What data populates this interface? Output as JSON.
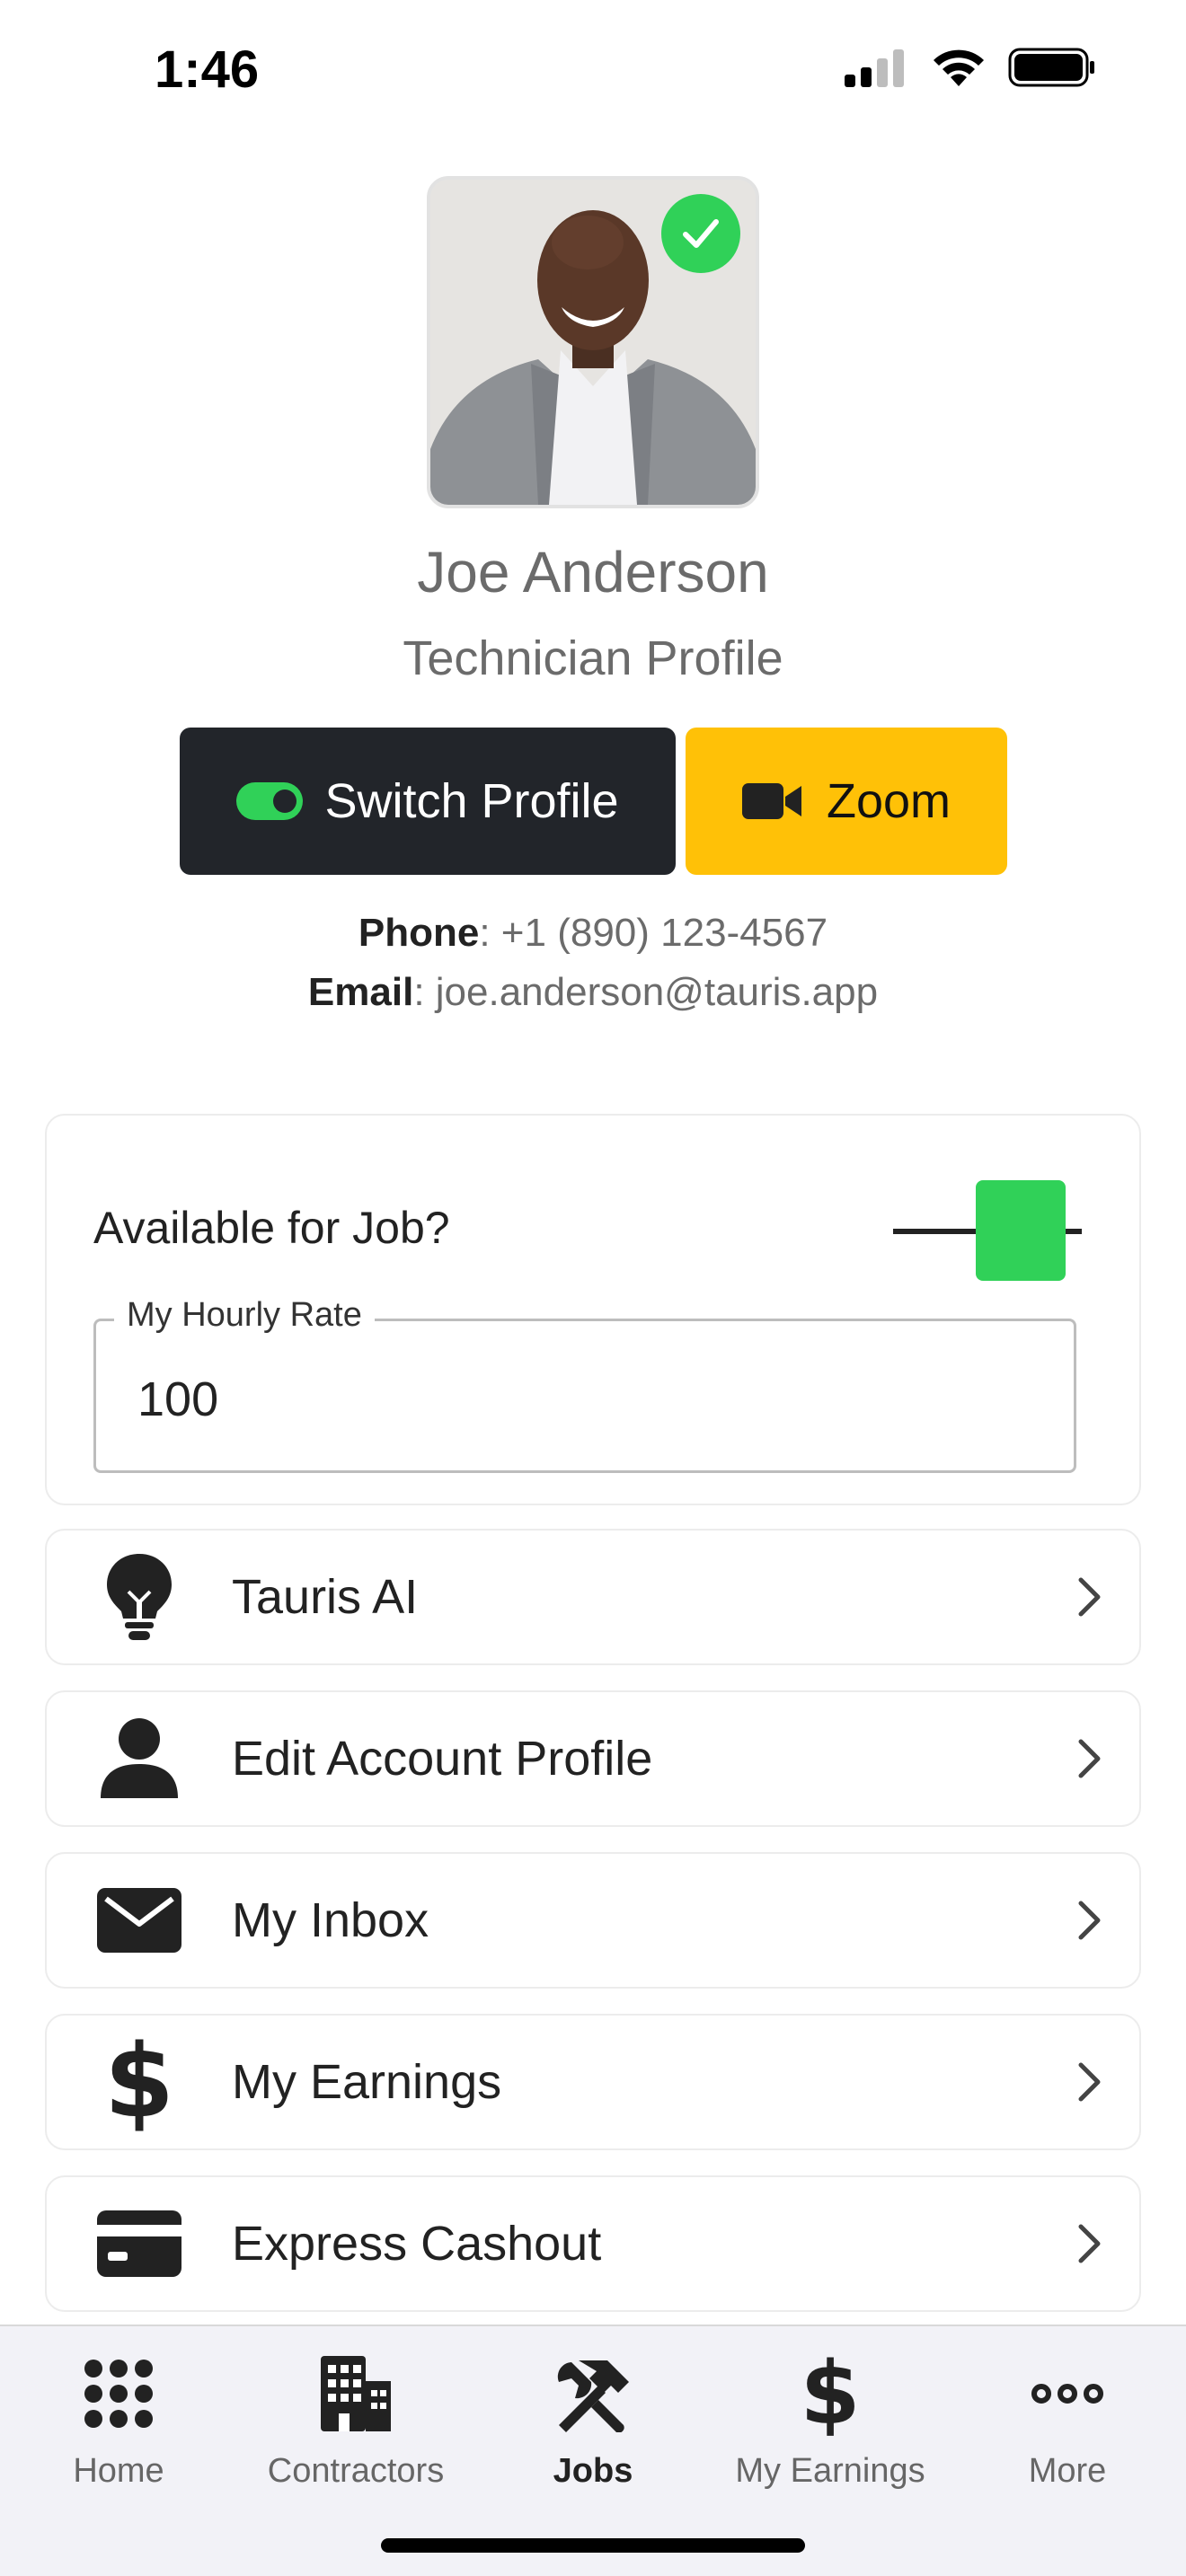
{
  "status_bar": {
    "time": "1:46"
  },
  "profile": {
    "name": "Joe Anderson",
    "role": "Technician Profile",
    "phone_label": "Phone",
    "phone_value": ": +1 (890) 123-4567",
    "email_label": "Email",
    "email_value": ": joe.anderson@tauris.app"
  },
  "actions": {
    "switch_profile": "Switch Profile",
    "zoom": "Zoom"
  },
  "availability": {
    "label": "Available for Job?",
    "enabled": true,
    "rate_label": "My Hourly Rate",
    "rate_value": "100"
  },
  "menu": [
    {
      "label": "Tauris AI",
      "icon": "lightbulb-icon"
    },
    {
      "label": "Edit Account Profile",
      "icon": "person-icon"
    },
    {
      "label": "My Inbox",
      "icon": "envelope-icon"
    },
    {
      "label": "My Earnings",
      "icon": "dollar-icon"
    },
    {
      "label": "Express Cashout",
      "icon": "credit-card-icon"
    }
  ],
  "tabs": [
    {
      "label": "Home",
      "icon": "grid-dots-icon",
      "active": false
    },
    {
      "label": "Contractors",
      "icon": "building-icon",
      "active": false
    },
    {
      "label": "Jobs",
      "icon": "tools-icon",
      "active": true
    },
    {
      "label": "My Earnings",
      "icon": "dollar-icon",
      "active": false
    },
    {
      "label": "More",
      "icon": "ellipsis-icon",
      "active": false
    }
  ],
  "colors": {
    "accent_green": "#30d158",
    "zoom_yellow": "#ffc107",
    "dark_button": "#22252a"
  }
}
